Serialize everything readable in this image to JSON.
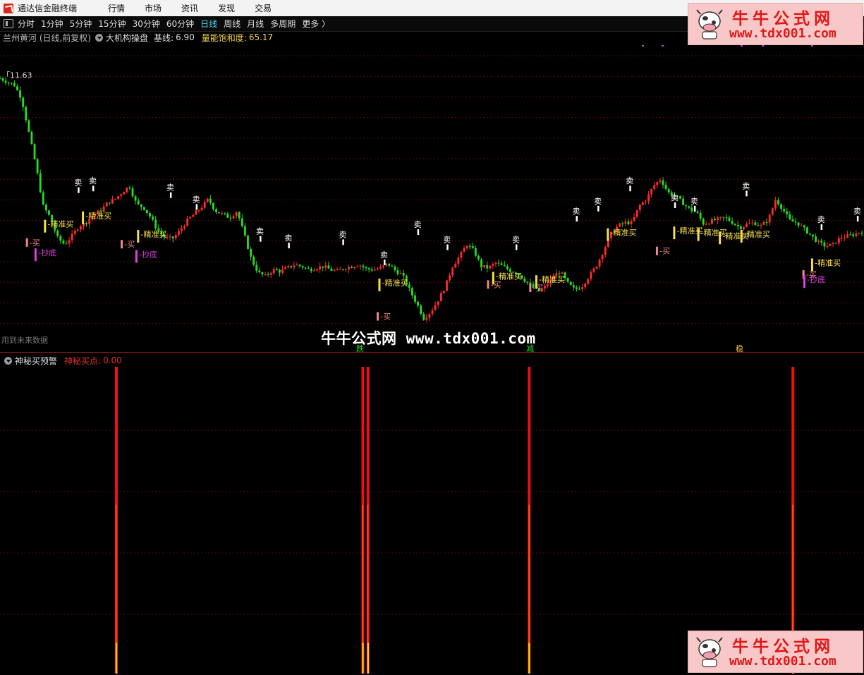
{
  "app": {
    "title": "通达信金融终端"
  },
  "menu": [
    "行情",
    "市场",
    "资讯",
    "发现",
    "交易"
  ],
  "periods": [
    {
      "label": "分时",
      "active": false
    },
    {
      "label": "1分钟",
      "active": false
    },
    {
      "label": "5分钟",
      "active": false
    },
    {
      "label": "15分钟",
      "active": false
    },
    {
      "label": "30分钟",
      "active": false
    },
    {
      "label": "60分钟",
      "active": false
    },
    {
      "label": "日线",
      "active": true
    },
    {
      "label": "周线",
      "active": false
    },
    {
      "label": "月线",
      "active": false
    },
    {
      "label": "多周期",
      "active": false
    },
    {
      "label": "更多 〉",
      "active": false
    }
  ],
  "side_digit": "1",
  "info": {
    "stock": "兰州黄河 (日线,前复权)",
    "indicator": "大机构操盘",
    "base_label": "基线:",
    "base_value": "6.90",
    "saturation_label": "量能饱和度:",
    "saturation_value": "65.17"
  },
  "price_high_label": "11.63",
  "future_note": "用到未来数据",
  "watermark": {
    "cn": "牛牛公式网",
    "url": "www.tdx001.com"
  },
  "bottom_tags": [
    "跌",
    "减",
    "稳"
  ],
  "sub": {
    "name": "神秘买预警",
    "buy_label": "神秘买点:",
    "buy_value": "0.00"
  },
  "brand": {
    "line1": "牛牛公式网",
    "line2": "www.tdx001.com"
  },
  "colors": {
    "up": "#ff2a2a",
    "down": "#22dd22",
    "sell": "#ffffff",
    "precise_buy": "#f7e04a",
    "buy": "#f08888",
    "bottom": "#e040e0",
    "alert_red": "#ee1111",
    "alert_yellow": "#f2d000"
  },
  "chart_data": {
    "type": "candlestick",
    "ylim": [
      3.6,
      11.9
    ],
    "price_path": [
      11.5,
      11.4,
      11.3,
      10.9,
      9.9,
      8.9,
      7.7,
      7.35,
      6.75,
      6.55,
      6.8,
      7.1,
      7.2,
      7.45,
      7.55,
      7.8,
      7.9,
      8.1,
      8.3,
      7.75,
      7.65,
      7.35,
      6.95,
      6.75,
      6.72,
      6.95,
      7.25,
      7.45,
      7.65,
      7.9,
      7.55,
      7.45,
      7.35,
      7.55,
      6.85,
      6.1,
      5.7,
      5.6,
      5.8,
      5.75,
      5.85,
      5.95,
      5.9,
      5.8,
      5.85,
      5.9,
      5.8,
      5.75,
      5.85,
      5.9,
      5.95,
      5.82,
      5.8,
      5.85,
      5.98,
      5.78,
      5.65,
      5.2,
      4.8,
      4.35,
      4.55,
      4.9,
      5.3,
      5.9,
      6.2,
      6.55,
      6.35,
      5.9,
      5.85,
      6.0,
      5.9,
      5.78,
      5.7,
      5.5,
      5.3,
      5.15,
      5.3,
      5.6,
      5.75,
      5.4,
      5.2,
      5.3,
      5.6,
      5.9,
      6.35,
      6.85,
      7.1,
      7.2,
      7.2,
      7.7,
      7.9,
      8.3,
      8.5,
      8.1,
      8.0,
      7.8,
      7.6,
      7.5,
      7.15,
      7.25,
      7.3,
      7.35,
      7.2,
      7.05,
      7.15,
      7.2,
      7.1,
      7.3,
      7.9,
      7.6,
      7.25,
      7.2,
      7.0,
      6.8,
      6.6,
      6.5,
      6.55,
      6.75,
      6.8,
      6.85,
      6.95
    ],
    "markers": [
      {
        "label": "卖",
        "kind": "sell",
        "x": 0.091,
        "price": 8.0
      },
      {
        "label": "卖",
        "kind": "sell",
        "x": 0.108,
        "price": 8.05
      },
      {
        "label": "卖",
        "kind": "sell",
        "x": 0.198,
        "price": 7.85
      },
      {
        "label": "卖",
        "kind": "sell",
        "x": 0.228,
        "price": 7.5
      },
      {
        "label": "卖",
        "kind": "sell",
        "x": 0.302,
        "price": 6.55
      },
      {
        "label": "卖",
        "kind": "sell",
        "x": 0.335,
        "price": 6.35
      },
      {
        "label": "卖",
        "kind": "sell",
        "x": 0.398,
        "price": 6.45
      },
      {
        "label": "卖",
        "kind": "sell",
        "x": 0.446,
        "price": 5.85
      },
      {
        "label": "卖",
        "kind": "sell",
        "x": 0.485,
        "price": 6.75
      },
      {
        "label": "卖",
        "kind": "sell",
        "x": 0.519,
        "price": 6.3
      },
      {
        "label": "卖",
        "kind": "sell",
        "x": 0.599,
        "price": 6.3
      },
      {
        "label": "卖",
        "kind": "sell",
        "x": 0.669,
        "price": 7.15
      },
      {
        "label": "卖",
        "kind": "sell",
        "x": 0.694,
        "price": 7.45
      },
      {
        "label": "卖",
        "kind": "sell",
        "x": 0.731,
        "price": 8.05
      },
      {
        "label": "卖",
        "kind": "sell",
        "x": 0.783,
        "price": 7.55
      },
      {
        "label": "卖",
        "kind": "sell",
        "x": 0.806,
        "price": 7.45
      },
      {
        "label": "卖",
        "kind": "sell",
        "x": 0.866,
        "price": 7.9
      },
      {
        "label": "卖",
        "kind": "sell",
        "x": 0.953,
        "price": 6.9
      },
      {
        "label": "卖",
        "kind": "sell",
        "x": 0.995,
        "price": 7.15
      },
      {
        "label": "精准买",
        "kind": "precise",
        "x": 0.052,
        "price": 7.2
      },
      {
        "label": "精准买",
        "kind": "precise",
        "x": 0.096,
        "price": 7.45
      },
      {
        "label": "精准买",
        "kind": "precise",
        "x": 0.16,
        "price": 6.9
      },
      {
        "label": "精准买",
        "kind": "precise",
        "x": 0.44,
        "price": 5.45
      },
      {
        "label": "精准买",
        "kind": "precise",
        "x": 0.572,
        "price": 5.65
      },
      {
        "label": "精准买",
        "kind": "precise",
        "x": 0.622,
        "price": 5.55
      },
      {
        "label": "精准买",
        "kind": "precise",
        "x": 0.705,
        "price": 6.95
      },
      {
        "label": "精准买",
        "kind": "precise",
        "x": 0.782,
        "price": 7.0
      },
      {
        "label": "精准买",
        "kind": "precise",
        "x": 0.81,
        "price": 6.95
      },
      {
        "label": "精准买",
        "kind": "precise",
        "x": 0.835,
        "price": 6.85
      },
      {
        "label": "精准买",
        "kind": "precise",
        "x": 0.86,
        "price": 6.9
      },
      {
        "label": "精准买",
        "kind": "precise",
        "x": 0.942,
        "price": 6.05
      },
      {
        "label": "买",
        "kind": "buy",
        "x": 0.031,
        "price": 6.65
      },
      {
        "label": "买",
        "kind": "buy",
        "x": 0.141,
        "price": 6.6
      },
      {
        "label": "买",
        "kind": "buy",
        "x": 0.438,
        "price": 4.45
      },
      {
        "label": "买",
        "kind": "buy",
        "x": 0.566,
        "price": 5.4
      },
      {
        "label": "买",
        "kind": "buy",
        "x": 0.615,
        "price": 5.3
      },
      {
        "label": "买",
        "kind": "buy",
        "x": 0.762,
        "price": 6.4
      },
      {
        "label": "买",
        "kind": "buy",
        "x": 0.932,
        "price": 5.7
      },
      {
        "label": "抄底",
        "kind": "bottom",
        "x": 0.041,
        "price": 6.35
      },
      {
        "label": "抄底",
        "kind": "bottom",
        "x": 0.158,
        "price": 6.3
      },
      {
        "label": "抄底",
        "kind": "bottom",
        "x": 0.933,
        "price": 5.55
      }
    ],
    "alerts": [
      {
        "x": 0.135,
        "value": 1.0
      },
      {
        "x": 0.421,
        "value": 1.0
      },
      {
        "x": 0.427,
        "value": 1.0
      },
      {
        "x": 0.614,
        "value": 1.0
      },
      {
        "x": 0.92,
        "value": 1.0
      }
    ]
  }
}
